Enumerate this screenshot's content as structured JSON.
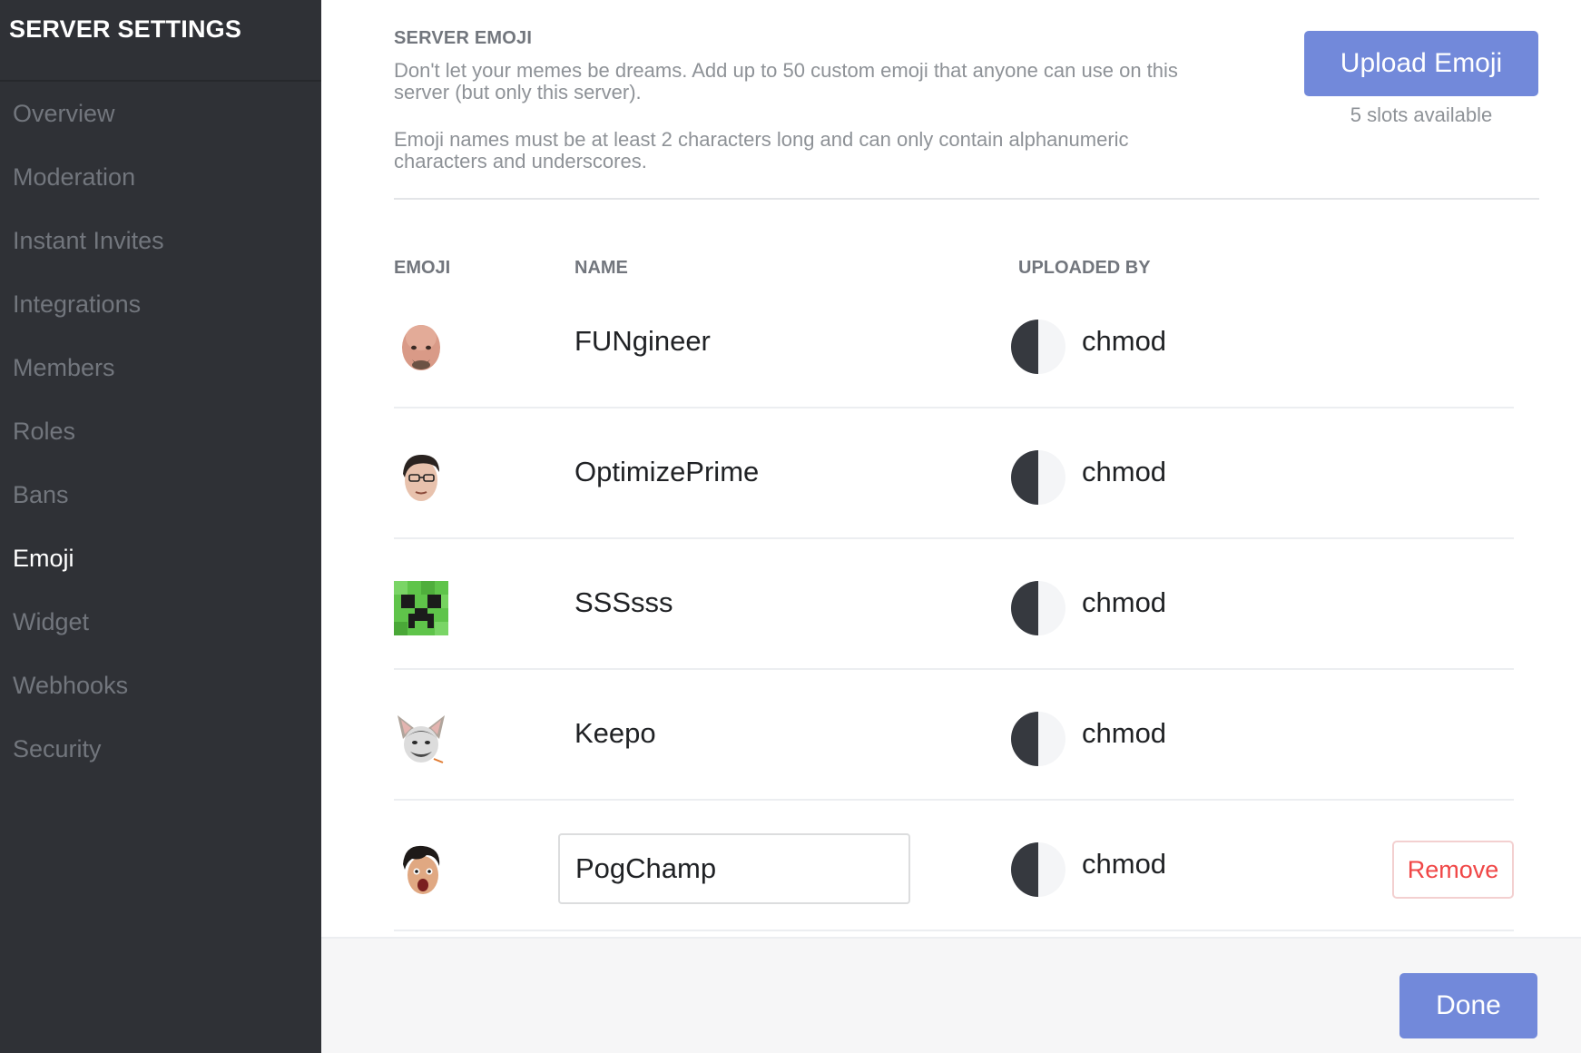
{
  "sidebar": {
    "title": "SERVER SETTINGS",
    "items": [
      {
        "label": "Overview"
      },
      {
        "label": "Moderation"
      },
      {
        "label": "Instant Invites"
      },
      {
        "label": "Integrations"
      },
      {
        "label": "Members"
      },
      {
        "label": "Roles"
      },
      {
        "label": "Bans"
      },
      {
        "label": "Emoji"
      },
      {
        "label": "Widget"
      },
      {
        "label": "Webhooks"
      },
      {
        "label": "Security"
      }
    ],
    "active_item": "Emoji"
  },
  "header": {
    "title": "SERVER EMOJI",
    "description_1": "Don't let your memes be dreams. Add up to 50 custom emoji that anyone can use on this server (but only this server).",
    "description_2": "Emoji names must be at least 2 characters long and can only contain alphanumeric characters and underscores.",
    "upload_label": "Upload Emoji",
    "slots_text": "5 slots available"
  },
  "table": {
    "columns": {
      "emoji": "EMOJI",
      "name": "NAME",
      "uploaded_by": "UPLOADED BY"
    },
    "rows": [
      {
        "emoji_icon": "bald-man-face-icon",
        "name": "FUNgineer",
        "uploader": "chmod"
      },
      {
        "emoji_icon": "man-face-icon",
        "name": "OptimizePrime",
        "uploader": "chmod"
      },
      {
        "emoji_icon": "creeper-face-icon",
        "name": "SSSsss",
        "uploader": "chmod"
      },
      {
        "emoji_icon": "cat-ears-face-icon",
        "name": "Keepo",
        "uploader": "chmod"
      },
      {
        "emoji_icon": "surprised-face-icon",
        "name": "PogChamp",
        "uploader": "chmod",
        "editing": true,
        "remove_label": "Remove"
      }
    ]
  },
  "footer": {
    "done_label": "Done"
  },
  "colors": {
    "sidebar_bg": "#2f3136",
    "accent": "#7289da",
    "danger": "#f04747"
  }
}
